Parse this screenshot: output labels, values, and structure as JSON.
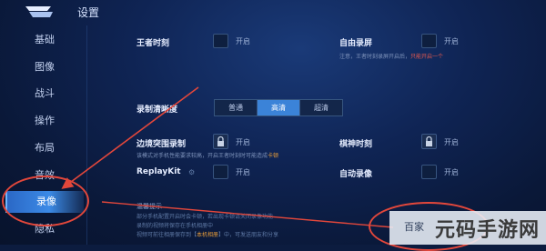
{
  "header": {
    "title": "设置"
  },
  "sidebar": {
    "items": [
      {
        "label": "基础"
      },
      {
        "label": "图像"
      },
      {
        "label": "战斗"
      },
      {
        "label": "操作"
      },
      {
        "label": "布局"
      },
      {
        "label": "音效"
      },
      {
        "label": "录像"
      },
      {
        "label": "隐私"
      }
    ],
    "active_index": 6
  },
  "settings": {
    "wangzhe": {
      "label": "王者时刻",
      "toggle": "开启"
    },
    "free_record": {
      "label": "自由录屏",
      "toggle": "开启",
      "note_pre": "注意，王者时刻录屏开启后，",
      "note_hl": "只能开启一个"
    },
    "quality": {
      "label": "录制清晰度",
      "options": [
        "普通",
        "高清",
        "超清"
      ],
      "selected": "高清"
    },
    "yuanzheng": {
      "label": "边境突围录制",
      "toggle": "开启",
      "note_pre": "该模式对手机性能要求较高，开启王者时刻时可能造成",
      "note_hl": "卡顿"
    },
    "qishen": {
      "label": "棋神时刻",
      "toggle": "开启"
    },
    "replaykit": {
      "label": "ReplayKit",
      "toggle": "开启"
    },
    "auto_record": {
      "label": "自动录像",
      "toggle": "开启"
    }
  },
  "description": {
    "title": "温馨提示",
    "line1": "部分手机配置开启时会卡顿，若出现卡顿请关闭录像功能",
    "line2": "录制的视频将保存在手机相册中",
    "line3_pre": "视频可前往相册保存到【",
    "line3_hl": "本机相册",
    "line3_post": "】中，可发送朋友和分享"
  },
  "watermark": {
    "small": "百家",
    "large": "元码手游网"
  },
  "colors": {
    "accent": "#3b83d8",
    "annotation": "#e2473b",
    "highlight": "#e49b3a",
    "warning": "#e1584f"
  }
}
